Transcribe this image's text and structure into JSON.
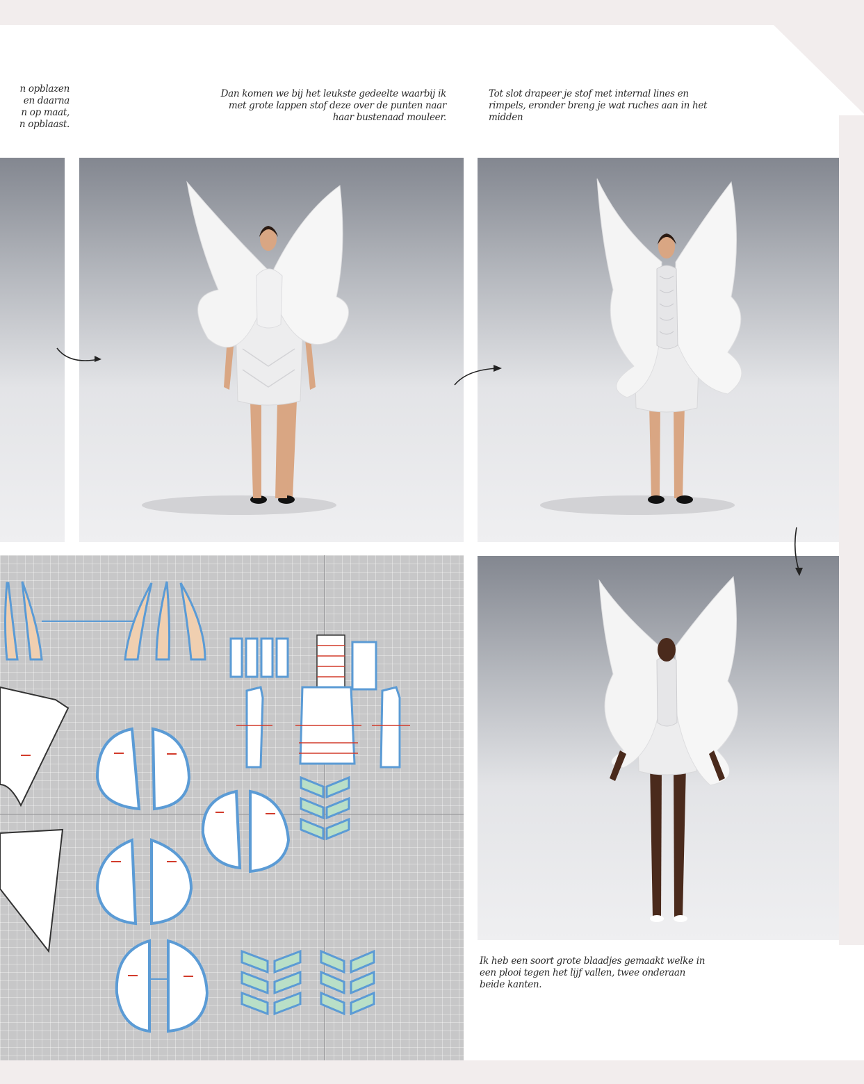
{
  "captions": {
    "left": [
      "n opblazen",
      "en daarna",
      "n op maat,",
      "n opblaast."
    ],
    "middle": [
      "Dan komen we bij het leukste gedeelte waarbij ik",
      "met grote lappen stof deze over de punten naar",
      "haar bustenaad mouleer."
    ],
    "right": [
      "Tot slot drapeer je stof met internal lines en",
      "rimpels, eronder breng je wat ruches aan in het",
      "midden"
    ],
    "bottom": [
      "Ik heb een soort grote blaadjes gemaakt welke in",
      "een plooi tegen het lijf vallen, twee onderaan",
      "beide kanten."
    ]
  },
  "colors": {
    "page": "#ffffff",
    "paper_edge": "#f2eded",
    "pattern_bg": "#c7c7c8",
    "piece_outline": "#5b9bd5",
    "piece_fill": "#ffffff",
    "horn_fill": "#f0cfb0",
    "panel_green": "#b9dfc7",
    "internal_line": "#d23b2b",
    "garment": "#f4f4f4",
    "skin_light": "#d9a683",
    "skin_dark": "#4a2a1c"
  },
  "icons": [
    "curved-arrow-right-icon",
    "curved-arrow-right-icon",
    "curved-arrow-down-icon"
  ]
}
